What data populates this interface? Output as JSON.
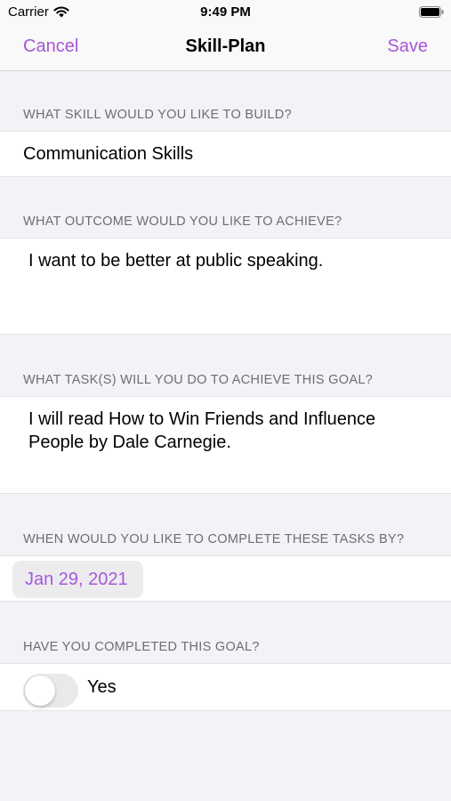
{
  "status_bar": {
    "carrier": "Carrier",
    "time": "9:49 PM"
  },
  "nav": {
    "cancel": "Cancel",
    "title": "Skill-Plan",
    "save": "Save"
  },
  "sections": {
    "skill": {
      "header": "WHAT SKILL WOULD YOU LIKE TO BUILD?",
      "value": "Communication Skills"
    },
    "outcome": {
      "header": "WHAT OUTCOME WOULD YOU LIKE TO ACHIEVE?",
      "value": "I want to be better at public speaking."
    },
    "tasks": {
      "header": "WHAT TASK(S) WILL YOU DO TO ACHIEVE THIS GOAL?",
      "value": "I will read How to Win Friends and Influence People by Dale Carnegie."
    },
    "due": {
      "header": "WHEN WOULD YOU LIKE TO COMPLETE THESE TASKS BY?",
      "value": "Jan 29, 2021"
    },
    "completed": {
      "header": "HAVE YOU COMPLETED THIS GOAL?",
      "label": "Yes",
      "on": false
    }
  },
  "colors": {
    "accent": "#a657d9",
    "background": "#f2f2f7",
    "secondary_text": "#6d6d72"
  },
  "icons": [
    "wifi-icon",
    "battery-icon"
  ]
}
